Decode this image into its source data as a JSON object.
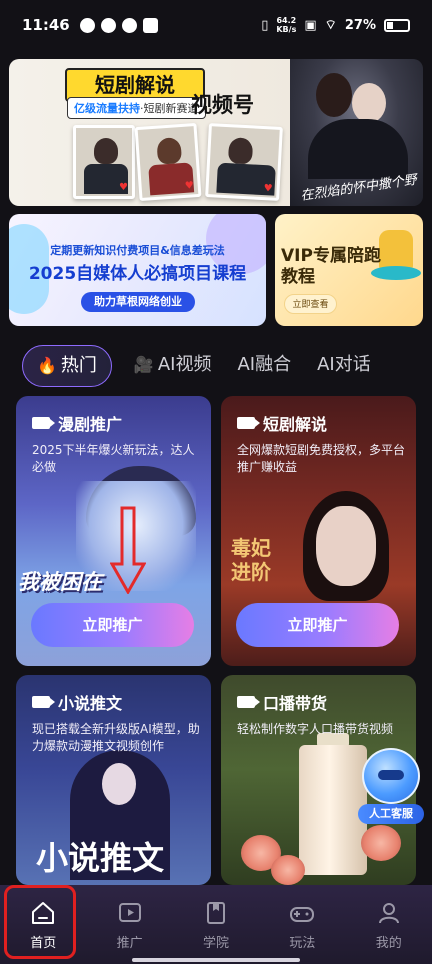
{
  "status_bar": {
    "time": "11:46",
    "net_speed": "64.2",
    "net_unit": "KB/s",
    "battery": "27%"
  },
  "hero": {
    "tag": "短剧解说",
    "subtag_a": "亿级流量扶持",
    "subtag_b": "·短剧新赛道",
    "platform": "视频号",
    "poster_title": "在烈焰的怀中撒个野"
  },
  "course_banner": {
    "line1": "定期更新知识付费项目&信息差玩法",
    "line2": "2025自媒体人必搞项目课程",
    "button": "助力草根网络创业"
  },
  "vip_banner": {
    "title": "VIP专属陪跑教程",
    "button": "立即查看"
  },
  "tabs": [
    {
      "label": "热门",
      "icon": "fire-icon",
      "active": true
    },
    {
      "label": "AI视频",
      "icon": "camera-icon",
      "active": false
    },
    {
      "label": "AI融合",
      "active": false
    },
    {
      "label": "AI对话",
      "active": false
    }
  ],
  "cards": [
    {
      "title": "漫剧推广",
      "desc": "2025下半年爆火新玩法，达人必做",
      "art_text": "我被困在",
      "cta": "立即推广"
    },
    {
      "title": "短剧解说",
      "desc": "全网爆款短剧免费授权，多平台推广赚收益",
      "art_text": "毒妃进阶",
      "cta": "立即推广"
    },
    {
      "title": "小说推文",
      "desc": "现已搭载全新升级版AI模型，助力爆款动漫推文视频创作",
      "art_text": "小说推文"
    },
    {
      "title": "口播带货",
      "desc": "轻松制作数字人口播带货视频"
    }
  ],
  "service": {
    "label": "人工客服"
  },
  "nav": [
    {
      "label": "首页",
      "icon": "home-icon",
      "active": true
    },
    {
      "label": "推广",
      "icon": "play-icon",
      "active": false
    },
    {
      "label": "学院",
      "icon": "book-icon",
      "active": false
    },
    {
      "label": "玩法",
      "icon": "gamepad-icon",
      "active": false
    },
    {
      "label": "我的",
      "icon": "person-icon",
      "active": false
    }
  ],
  "colors": {
    "accent": "#8e6bff",
    "cta_start": "#6a79ff",
    "cta_end": "#e67ee5",
    "highlight": "#e02020"
  }
}
